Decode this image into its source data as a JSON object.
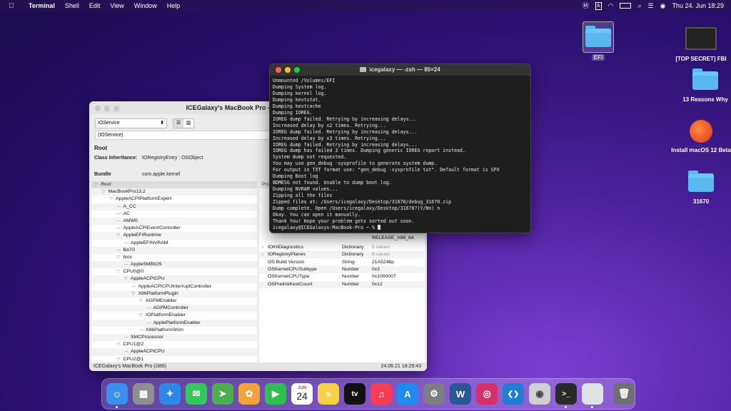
{
  "menubar": {
    "app_name": "Terminal",
    "menus": [
      "Shell",
      "Edit",
      "View",
      "Window",
      "Help"
    ],
    "clock": "Thu 24. Jun  18:29",
    "status_icons": [
      "m-icon",
      "A",
      "wifi-icon",
      "battery-icon",
      "search-icon",
      "control-center-icon",
      "siri-icon"
    ]
  },
  "desktop": {
    "efi_label": "EFI",
    "items": [
      {
        "label": "[TOP SECRET] FBI"
      },
      {
        "label": "13 Reasons Why"
      },
      {
        "label": "Install macOS 12 Beta"
      },
      {
        "label": "31670"
      }
    ]
  },
  "ioreg": {
    "title": "ICEGalaxy's MacBook Pro - IORegistryExplorer",
    "plane_select": "IOService",
    "filter": "(IOService)",
    "heading": "Root",
    "class_label": "Class Inheritance:",
    "class_value": "IORegistryEntry : OSObject",
    "bundle_label": "Bundle",
    "bundle_value": "com.apple.kernel",
    "props_header": "Pro",
    "tree": [
      {
        "label": "Root",
        "depth": 0,
        "arrow": "▽",
        "sel": true
      },
      {
        "label": "MacBookPro13,2",
        "depth": 1,
        "arrow": "▽"
      },
      {
        "label": "AppleACPIPlatformExpert",
        "depth": 2,
        "arrow": "▽"
      },
      {
        "label": "A_CC",
        "depth": 3,
        "arrow": ""
      },
      {
        "label": "AC",
        "depth": 3,
        "arrow": ""
      },
      {
        "label": "AMW0",
        "depth": 3,
        "arrow": ""
      },
      {
        "label": "AppleACPIEventController",
        "depth": 3,
        "arrow": ""
      },
      {
        "label": "AppleEFIRuntime",
        "depth": 3,
        "arrow": "▽"
      },
      {
        "label": "AppleEFINVRAM",
        "depth": 4,
        "arrow": ""
      },
      {
        "label": "BAT0",
        "depth": 3,
        "arrow": ""
      },
      {
        "label": "bios",
        "depth": 3,
        "arrow": "▽"
      },
      {
        "label": "AppleSMBIOS",
        "depth": 4,
        "arrow": ""
      },
      {
        "label": "CPU0@0",
        "depth": 3,
        "arrow": "▽"
      },
      {
        "label": "AppleACPICPU",
        "depth": 4,
        "arrow": "▽"
      },
      {
        "label": "AppleACPICPUInterruptController",
        "depth": 5,
        "arrow": ""
      },
      {
        "label": "X86PlatformPlugin",
        "depth": 5,
        "arrow": "▽"
      },
      {
        "label": "AGPMEnabler",
        "depth": 6,
        "arrow": "▽"
      },
      {
        "label": "AGPMController",
        "depth": 7,
        "arrow": ""
      },
      {
        "label": "IOPlatformEnabler",
        "depth": 6,
        "arrow": "▽"
      },
      {
        "label": "ApplePlatformEnabler",
        "depth": 7,
        "arrow": ""
      },
      {
        "label": "X86PlatformShim",
        "depth": 6,
        "arrow": ""
      },
      {
        "label": "SMCProcessor",
        "depth": 4,
        "arrow": ""
      },
      {
        "label": "CPU1@2",
        "depth": 3,
        "arrow": "▽"
      },
      {
        "label": "AppleACPICPU",
        "depth": 4,
        "arrow": ""
      },
      {
        "label": "CPU2@1",
        "depth": 3,
        "arrow": "▽"
      }
    ],
    "props_top": [
      {
        "k": "",
        "t": "",
        "v": "1.2~2/"
      },
      {
        "k": "",
        "t": "",
        "v": "RELEASE_X86_64"
      }
    ],
    "props": [
      {
        "k": "IOKitDiagnostics",
        "t": "Dictionary",
        "v": "5 values",
        "tw": "›"
      },
      {
        "k": "IORegistryPlanes",
        "t": "Dictionary",
        "v": "8 values",
        "tw": "›"
      },
      {
        "k": "OS Build Version",
        "t": "String",
        "v": "21A5248p",
        "tw": ""
      },
      {
        "k": "OSKernelCPUSubtype",
        "t": "Number",
        "v": "0x3",
        "tw": ""
      },
      {
        "k": "OSKernelCPUType",
        "t": "Number",
        "v": "0x1000007",
        "tw": ""
      },
      {
        "k": "OSPrelinkKextCount",
        "t": "Number",
        "v": "0x12",
        "tw": ""
      }
    ],
    "status_left": "ICEGalaxy's MacBook Pro (i386)",
    "status_right": "24.06.21 18:29:43"
  },
  "terminal": {
    "title": "icegalaxy — -zsh — 80×24",
    "lines": [
      "Unmounted /Volumes/EFI",
      "Dumping System log.",
      "Dumping kernel log.",
      "Dumping kextstat.",
      "Dumping kextcache",
      "Dumping IOREG.",
      "IOREG dump failed. Retrying by increasing delays...",
      "Increased delay by x2 times. Retrying...",
      "IOREG dump failed. Retrying by increasing delays...",
      "Increased delay by x3 times. Retrying...",
      "IOREG dump failed. Retrying by increasing delays...",
      "IOREG dump has failed 3 times. Dumping generic IOREG report instead.",
      "System dump not requested.",
      "You may use gen_debug -sysprofile to generate system dump.",
      "For output in TXT format use: \"gen_debug -sysprofile txt\". Default format is SPX",
      "Dumping Boot log",
      "BDMESG not found. Unable to dump boot log.",
      "Dumping NVRAM values...",
      "Zipping all the files",
      "Zipped files at: /Users/icegalaxy/Desktop/31670/debug_31670.zip",
      "Dump complete. Open /Users/icegalaxy/Desktop/31670?(Y/Nn) n",
      "Okay. You can open it manually.",
      "Thank You! Hope your problem gets sorted out soon."
    ],
    "prompt": "icegalaxy@ICEGalaxys-MacBook-Pro ~ % "
  },
  "dock": {
    "calendar_month": "JUN",
    "calendar_day": "24",
    "apps": [
      {
        "name": "finder",
        "glyph": "☺",
        "color": "#3a8ef0",
        "running": true
      },
      {
        "name": "launchpad",
        "glyph": "▦",
        "color": "#8e8e93",
        "running": false
      },
      {
        "name": "safari",
        "glyph": "✦",
        "color": "#2f87e8",
        "running": false
      },
      {
        "name": "messages",
        "glyph": "✉",
        "color": "#34c759",
        "running": false
      },
      {
        "name": "maps",
        "glyph": "➤",
        "color": "#4cae4f",
        "running": false
      },
      {
        "name": "photos",
        "glyph": "✿",
        "color": "#f2a33a",
        "running": false
      },
      {
        "name": "facetime",
        "glyph": "▶",
        "color": "#2fbf4f",
        "running": false
      },
      {
        "name": "calendar",
        "glyph": "",
        "color": "#ffffff",
        "running": false
      },
      {
        "name": "notes",
        "glyph": "≡",
        "color": "#f7d046",
        "running": false
      },
      {
        "name": "apple-tv",
        "glyph": "tv",
        "color": "#111111",
        "running": false
      },
      {
        "name": "music",
        "glyph": "♫",
        "color": "#fa3c55",
        "running": false
      },
      {
        "name": "app-store",
        "glyph": "A",
        "color": "#1c8cf1",
        "running": false
      },
      {
        "name": "system-preferences",
        "glyph": "⚙",
        "color": "#7d7d84",
        "running": false
      },
      {
        "name": "word",
        "glyph": "W",
        "color": "#2b5797",
        "running": false
      },
      {
        "name": "instagram",
        "glyph": "◎",
        "color": "#d6306a",
        "running": false
      },
      {
        "name": "vscode",
        "glyph": "❮❯",
        "color": "#1f7dd4",
        "running": false
      },
      {
        "name": "screenshot",
        "glyph": "◉",
        "color": "#cfcfd4",
        "running": false
      },
      {
        "name": "terminal",
        "glyph": ">_",
        "color": "#2a2a2a",
        "running": true
      },
      {
        "name": "ioregistryexplorer",
        "glyph": "",
        "color": "#dfe3e8",
        "running": true
      },
      {
        "name": "trash",
        "glyph": "🗑",
        "color": "#6f6f78",
        "running": false
      }
    ]
  }
}
